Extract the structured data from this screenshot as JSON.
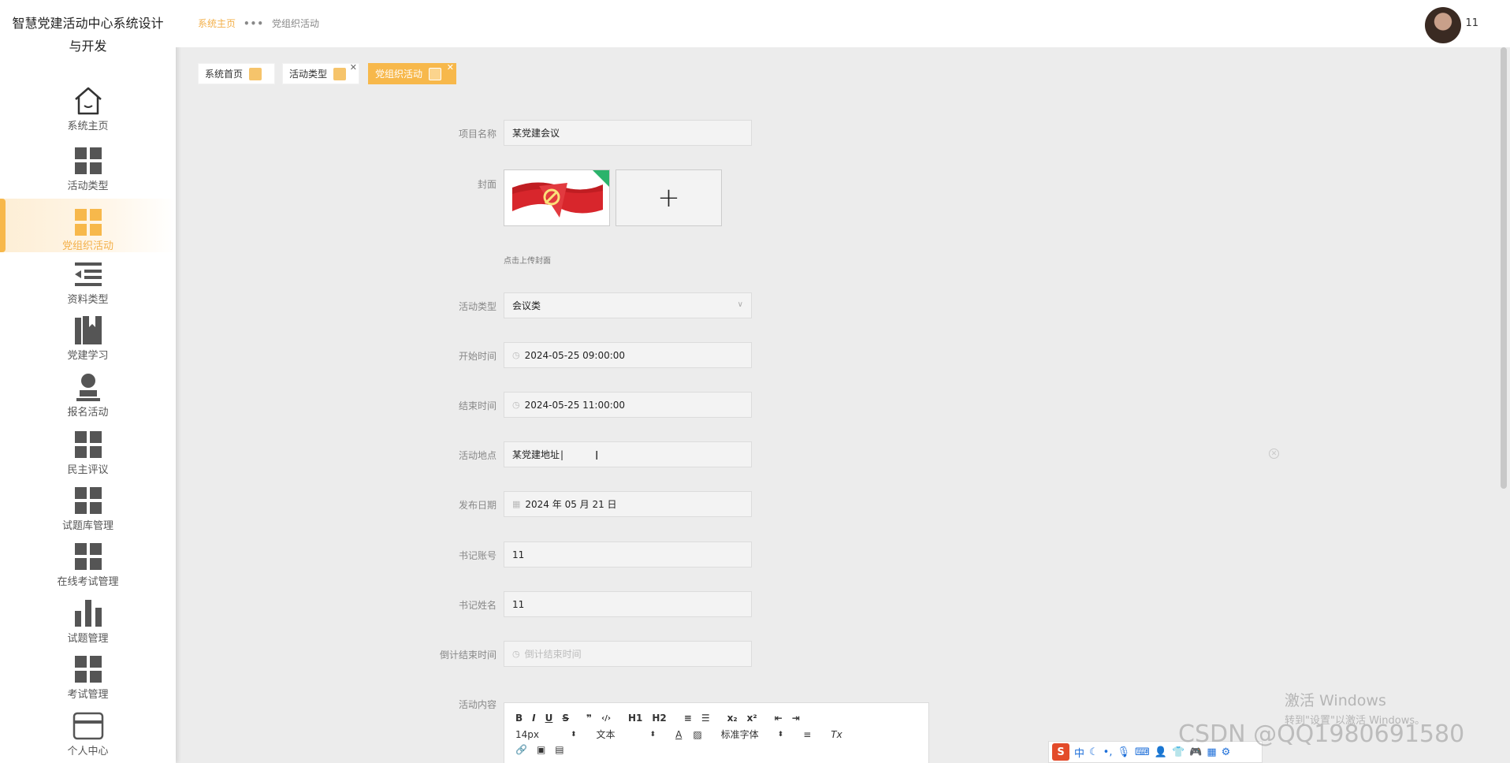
{
  "app": {
    "title": "智慧党建活动中心系统设计与开发"
  },
  "sidebar": {
    "items": [
      {
        "label": "系统主页",
        "icon": "home-icon"
      },
      {
        "label": "活动类型",
        "icon": "grid-icon"
      },
      {
        "label": "党组织活动",
        "icon": "grid-icon",
        "active": true
      },
      {
        "label": "资料类型",
        "icon": "list-icon"
      },
      {
        "label": "党建学习",
        "icon": "book-icon"
      },
      {
        "label": "报名活动",
        "icon": "user-icon"
      },
      {
        "label": "民主评议",
        "icon": "grid-icon"
      },
      {
        "label": "试题库管理",
        "icon": "grid-icon"
      },
      {
        "label": "在线考试管理",
        "icon": "grid-icon"
      },
      {
        "label": "试题管理",
        "icon": "bar-chart-icon"
      },
      {
        "label": "考试管理",
        "icon": "grid-icon"
      },
      {
        "label": "个人中心",
        "icon": "card-icon"
      }
    ]
  },
  "header": {
    "breadcrumb_home": "系统主页",
    "breadcrumb_sep": "•••",
    "breadcrumb_current": "党组织活动",
    "username": "11"
  },
  "tabs": [
    {
      "label": "系统首页",
      "active": false,
      "closable": false
    },
    {
      "label": "活动类型",
      "active": false,
      "closable": true
    },
    {
      "label": "党组织活动",
      "active": true,
      "closable": true
    }
  ],
  "form": {
    "name_label": "项目名称",
    "name_value": "某党建会议",
    "cover_label": "封面",
    "cover_hint": "点击上传封面",
    "cover_add": "+",
    "type_label": "活动类型",
    "type_value": "会议类",
    "start_label": "开始时间",
    "start_value": "2024-05-25 09:00:00",
    "end_label": "结束时间",
    "end_value": "2024-05-25 11:00:00",
    "place_label": "活动地点",
    "place_value": "某党建地址",
    "publish_label": "发布日期",
    "publish_value": "2024 年 05 月 21 日",
    "account_label": "书记账号",
    "account_value": "11",
    "secname_label": "书记姓名",
    "secname_value": "11",
    "countdown_label": "倒计结束时间",
    "countdown_placeholder": "倒计结束时间",
    "content_label": "活动内容"
  },
  "editor": {
    "row1": [
      "B",
      "I",
      "U",
      "S",
      "❞",
      "‹/›",
      "H1",
      "H2",
      "≡",
      "☰",
      "x₂",
      "x²",
      "⇤",
      "⇥"
    ],
    "font_size": "14px",
    "block_type": "文本",
    "font_family": "标准字体"
  },
  "watermark": {
    "line1": "激活 Windows",
    "line2": "转到\"设置\"以激活 Windows。"
  },
  "csdn": "CSDN @QQ1980691580",
  "ime": {
    "label": "中"
  }
}
